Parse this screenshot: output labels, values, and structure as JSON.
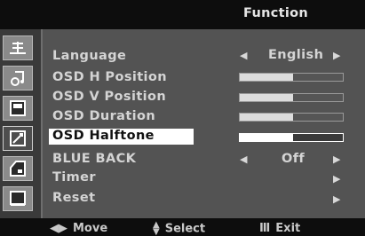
{
  "header": {
    "title": "Function"
  },
  "menu": {
    "language": {
      "label": "Language",
      "value": "English"
    },
    "h_position": {
      "label": "OSD  H Position",
      "level": 0.52
    },
    "v_position": {
      "label": "OSD  V Position",
      "level": 0.52
    },
    "duration": {
      "label": "OSD  Duration",
      "level": 0.52
    },
    "halftone": {
      "label": "OSD  Halftone",
      "level": 0.52
    },
    "blue_back": {
      "label": "BLUE BACK",
      "value": "Off"
    },
    "timer": {
      "label": "Timer"
    },
    "reset": {
      "label": "Reset"
    }
  },
  "footer": {
    "move": {
      "label": "Move"
    },
    "select": {
      "label": "Select"
    },
    "exit": {
      "label": "Exit"
    }
  },
  "sidebar": {
    "tabs": [
      {
        "icon": "picture-adjust-icon"
      },
      {
        "icon": "color-adjust-icon"
      },
      {
        "icon": "image-setup-icon"
      },
      {
        "icon": "function-icon",
        "active": true
      },
      {
        "icon": "information-icon"
      },
      {
        "icon": "exit-icon"
      }
    ]
  }
}
